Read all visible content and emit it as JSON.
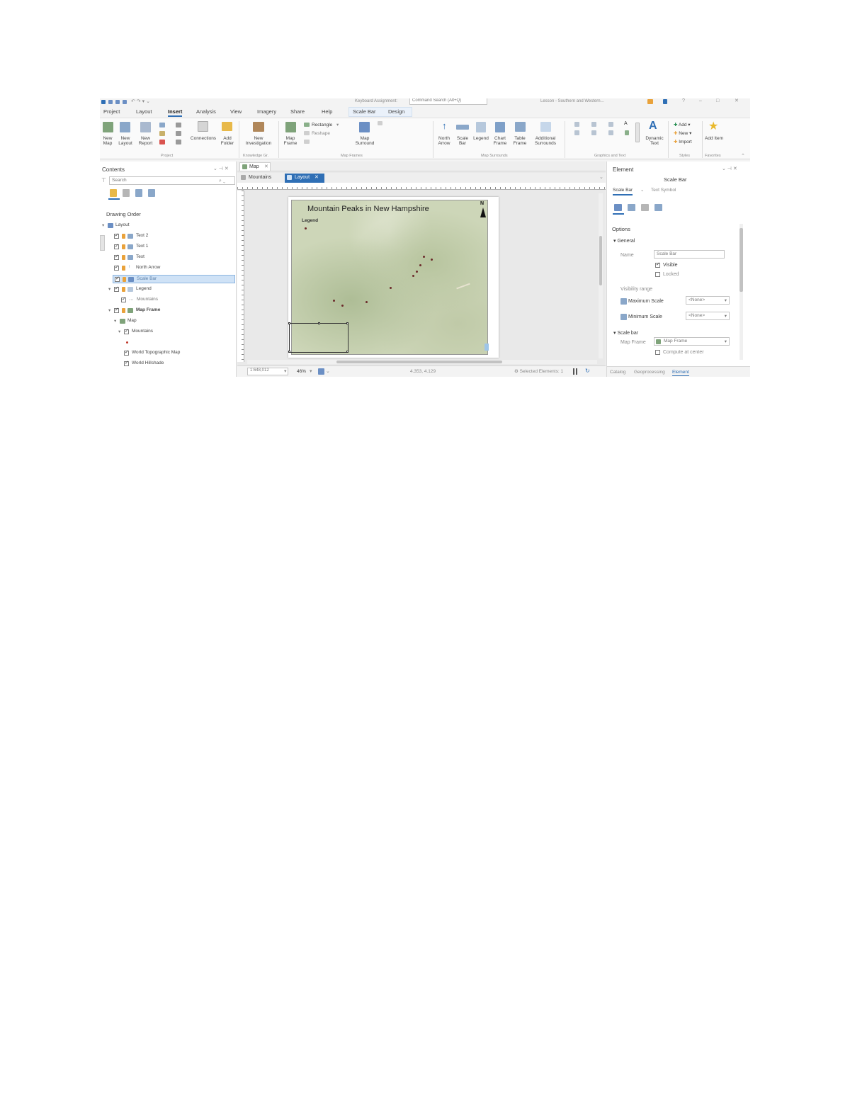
{
  "app": {
    "window_title": "Lesson - Southern and Western...",
    "command_search": "Command Search (Alt+Q)",
    "search_placeholder": "Search"
  },
  "ribbon_tabs": [
    "Project",
    "Layout",
    "Insert",
    "Analysis",
    "View",
    "Imagery",
    "Share",
    "Help",
    "Scale Bar",
    "Design"
  ],
  "ribbon": {
    "project_group": {
      "label": "Project",
      "buttons": [
        "New Map",
        "New Layout",
        "New Report",
        "Connections",
        "Add Folder"
      ]
    },
    "knowledge_group": {
      "label": "Knowledge Gr.",
      "buttons": [
        "New Investigation"
      ]
    },
    "map_frame_group": {
      "label": "Map Frames",
      "buttons": [
        "Map Frame",
        "Rectangle",
        "Reshape",
        "Map Surround"
      ]
    },
    "map_surrounds_group": {
      "label": "Map Surrounds",
      "buttons": [
        "North Arrow",
        "Scale Bar",
        "Legend",
        "Chart Frame",
        "Table Frame",
        "Additional Surrounds"
      ]
    },
    "graphics_group": {
      "label": "Graphics and Text",
      "buttons": [
        "Dynamic Text"
      ]
    },
    "styles_group": {
      "label": "Styles",
      "buttons": [
        "Add",
        "New",
        "Import"
      ]
    },
    "favorites_group": {
      "label": "Favorites",
      "buttons": [
        "Add Item"
      ]
    }
  },
  "contents": {
    "title": "Contents",
    "search_placeholder": "Search",
    "section": "Drawing Order",
    "items": [
      {
        "label": "Layout",
        "checked": false
      },
      {
        "label": "Text 2",
        "checked": true
      },
      {
        "label": "Text 1",
        "checked": true
      },
      {
        "label": "Text",
        "checked": true
      },
      {
        "label": "North Arrow",
        "checked": true
      },
      {
        "label": "Scale Bar",
        "checked": true,
        "selected": true
      },
      {
        "label": "Legend",
        "checked": true
      },
      {
        "label": "Mountains",
        "checked": true
      },
      {
        "label": "Map Frame",
        "checked": true
      },
      {
        "label": "Map",
        "checked": false
      },
      {
        "label": "Mountains",
        "checked": true
      },
      {
        "label": "World Topographic Map",
        "checked": true
      },
      {
        "label": "World Hillshade",
        "checked": true
      }
    ]
  },
  "view_tabs": {
    "top": [
      "Map"
    ],
    "bottom": [
      "Mountains",
      "Layout"
    ]
  },
  "layout": {
    "map_title": "Mountain Peaks in New Hampshire",
    "legend_label": "Legend",
    "north_arrow_label": "N"
  },
  "status_bar": {
    "scale": "1:648,012",
    "zoom": "46%",
    "coordinates": "4.353, 4.129",
    "selected": "Selected Elements: 1"
  },
  "element_pane": {
    "title": "Element",
    "subtitle": "Scale Bar",
    "tabs": [
      "Scale Bar",
      "Text Symbol"
    ],
    "section": "Options",
    "general_label": "General",
    "name_label": "Name",
    "name_value": "Scale Bar",
    "visible_label": "Visible",
    "locked_label": "Locked",
    "visibility_range_label": "Visibility range",
    "max_scale_label": "Maximum Scale",
    "max_scale_value": "<None>",
    "min_scale_label": "Minimum Scale",
    "min_scale_value": "<None>",
    "scale_bar_section": "Scale bar",
    "map_frame_label": "Map Frame",
    "map_frame_value": "Map Frame",
    "compute_label": "Compute at center",
    "bottom_tabs": [
      "Catalog",
      "Geoprocessing",
      "Element"
    ]
  },
  "colors": {
    "accent": "#2f6fb5",
    "selection": "#cfe2f6",
    "map_green": "#c8d3b0"
  }
}
